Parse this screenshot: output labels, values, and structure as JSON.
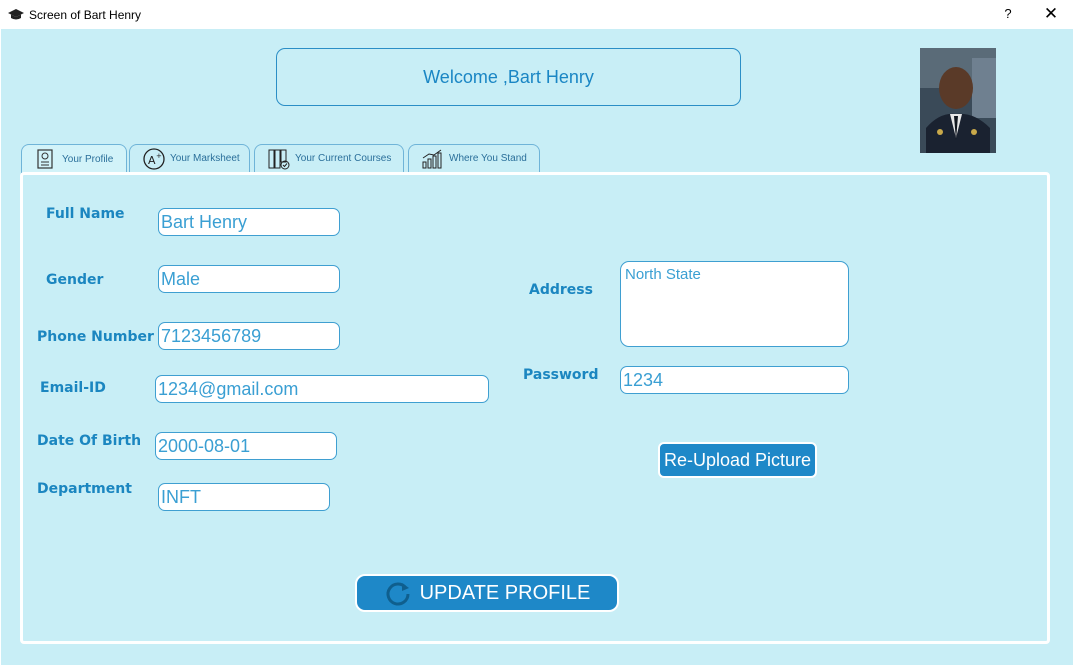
{
  "window": {
    "title": "Screen of Bart Henry",
    "help": "?",
    "close": "✕"
  },
  "header": {
    "welcome": "Welcome ,Bart Henry"
  },
  "tabs": [
    {
      "label": "Your Profile",
      "icon": "profile-doc-icon"
    },
    {
      "label": "Your Marksheet",
      "icon": "grade-a-plus-icon"
    },
    {
      "label": "Your Current Courses",
      "icon": "books-icon"
    },
    {
      "label": "Where You Stand",
      "icon": "bar-chart-icon"
    }
  ],
  "profile": {
    "full_name_label": "Full Name",
    "full_name": "Bart Henry",
    "gender_label": "Gender",
    "gender": "Male",
    "phone_label": "Phone Number",
    "phone": "7123456789",
    "email_label": "Email-ID",
    "email": "1234@gmail.com",
    "dob_label": "Date Of Birth",
    "dob": "2000-08-01",
    "department_label": "Department",
    "department": "INFT",
    "address_label": "Address",
    "address": "North State",
    "password_label": "Password",
    "password": "1234",
    "reupload_label": "Re-Upload Picture",
    "update_label": "UPDATE PROFILE"
  },
  "colors": {
    "accent": "#1e88c8",
    "background": "#c8eef6",
    "label": "#1b86c0"
  }
}
